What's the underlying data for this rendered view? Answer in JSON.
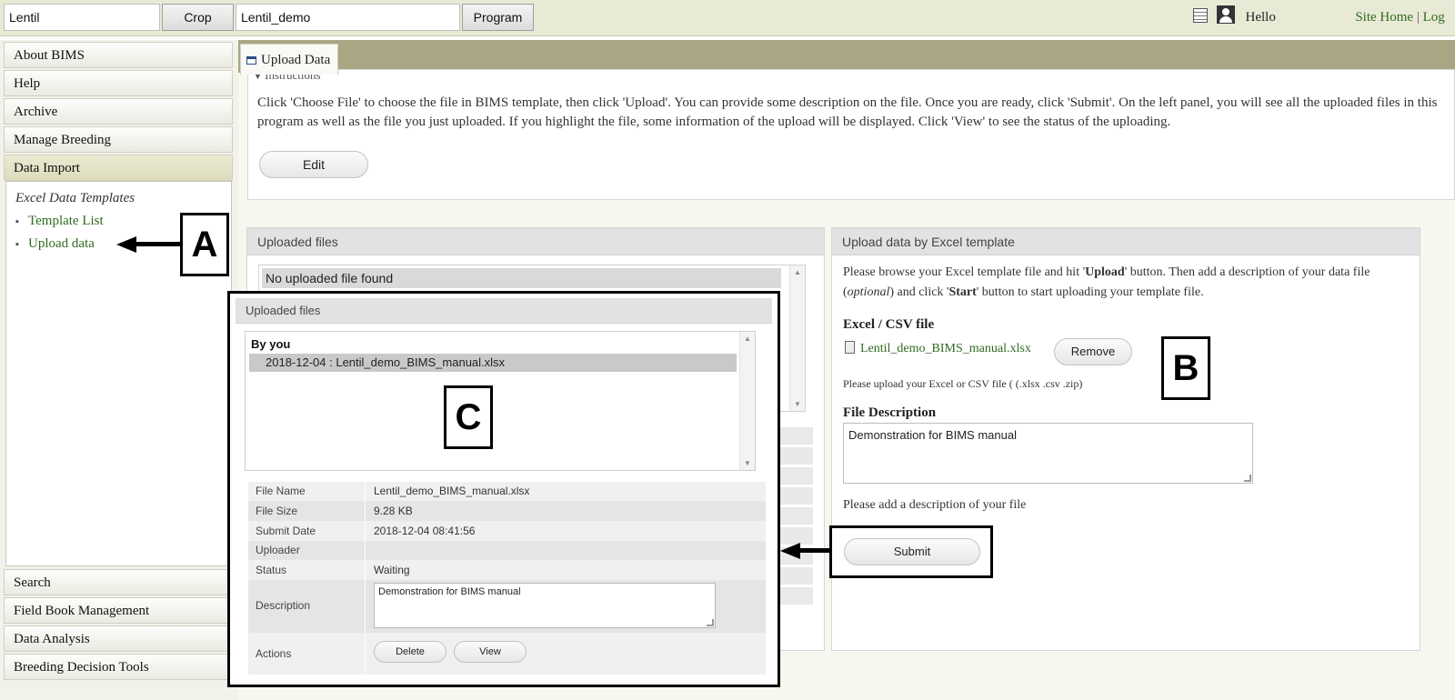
{
  "topbar": {
    "crop_value": "Lentil",
    "crop_button": "Crop",
    "program_value": "Lentil_demo",
    "program_button": "Program",
    "greeting": "Hello",
    "site_home": "Site Home",
    "separator": "|",
    "logout": "Log"
  },
  "sidebar": {
    "top_items": [
      "About BIMS",
      "Help",
      "Archive",
      "Manage Breeding",
      "Data Import"
    ],
    "panel_title": "Excel Data Templates",
    "panel_links": [
      "Template List",
      "Upload data"
    ],
    "bottom_items": [
      "Search",
      "Field Book Management",
      "Data Analysis",
      "Breeding Decision Tools"
    ]
  },
  "tab": {
    "label": "Upload Data"
  },
  "instructions": {
    "legend": "Instructions",
    "text": "Click 'Choose File' to choose the file in BIMS template, then click 'Upload'. You can provide some description on the file. Once you are ready, click 'Submit'. On the left panel, you will see all the uploaded files in this program as well as the file you just uploaded. If you highlight the file, some information of the upload will be displayed. Click 'View' to see the status of the uploading.",
    "edit_button": "Edit"
  },
  "uploaded_files": {
    "title": "Uploaded files",
    "empty_text": "No uploaded file found"
  },
  "excel_upload": {
    "title": "Upload data by Excel template",
    "intro_1": "Please browse your Excel template file and hit '",
    "intro_upload": "Upload",
    "intro_2": "' button. Then add a description of your data file (",
    "intro_optional": "optional",
    "intro_3": ") and click '",
    "intro_start": "Start",
    "intro_4": "' button to start uploading your template file.",
    "file_label": "Excel / CSV file",
    "file_name": "Lentil_demo_BIMS_manual.xlsx",
    "remove_button": "Remove",
    "file_hint": "Please upload your Excel or CSV file ( (.xlsx .csv .zip)",
    "desc_label": "File Description",
    "desc_value": "Demonstration for BIMS manual",
    "desc_hint": "Please add a description of your file",
    "submit_button": "Submit"
  },
  "overlay": {
    "title": "Uploaded files",
    "group": "By you",
    "selected_entry": "2018-12-04 : Lentil_demo_BIMS_manual.xlsx",
    "details": {
      "file_name_label": "File Name",
      "file_name": "Lentil_demo_BIMS_manual.xlsx",
      "file_size_label": "File Size",
      "file_size": "9.28 KB",
      "submit_date_label": "Submit Date",
      "submit_date": "2018-12-04 08:41:56",
      "uploader_label": "Uploader",
      "uploader": "",
      "status_label": "Status",
      "status": "Waiting",
      "description_label": "Description",
      "description": "Demonstration for BIMS manual",
      "actions_label": "Actions",
      "delete_button": "Delete",
      "view_button": "View"
    }
  },
  "callouts": {
    "a": "A",
    "b": "B",
    "c": "C"
  },
  "colors": {
    "link_green": "#2e6b1f",
    "topbar": "#e9ead6",
    "tabstrip": "#a9a683"
  }
}
